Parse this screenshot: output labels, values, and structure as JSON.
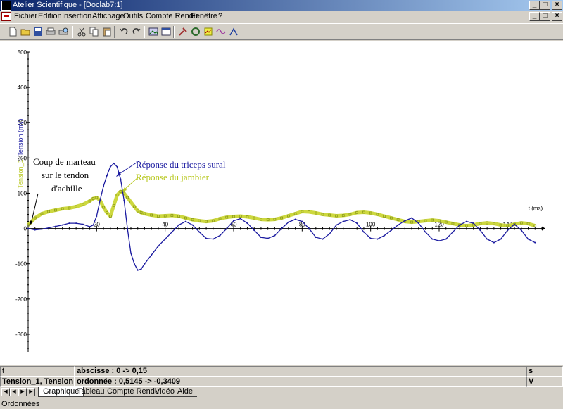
{
  "window": {
    "title": "Atelier Scientifique - [Doclab7:1]"
  },
  "menu": {
    "items": [
      "Fichier",
      "Edition",
      "Insertion",
      "Affichage",
      "Outils",
      "Compte Rendu",
      "Fenêtre",
      "?"
    ]
  },
  "toolbar": {
    "buttons": [
      "new-document-icon",
      "open-folder-icon",
      "save-icon",
      "print-icon",
      "print-preview-icon",
      "cut-icon",
      "copy-icon",
      "paste-icon",
      "undo-icon",
      "redo-icon",
      "image-icon",
      "window-icon",
      "tool-icon",
      "refresh-icon",
      "data-icon",
      "wave-icon",
      "graph-icon"
    ]
  },
  "chart_data": {
    "type": "line",
    "ylabel_parts": [
      "Tension_1",
      ", ",
      "Tension (mV)"
    ],
    "xlabel": "t (ms)",
    "xlim": [
      0,
      150
    ],
    "ylim": [
      -350,
      500
    ],
    "x_ticks": [
      20,
      40,
      60,
      80,
      100,
      120,
      140
    ],
    "x_tick_labels": [
      "20",
      "40",
      "60",
      "80",
      "100",
      "120",
      "140"
    ],
    "y_ticks": [
      500,
      400,
      300,
      200,
      100,
      0,
      -100,
      -200,
      -300
    ],
    "y_tick_labels": [
      "500",
      "400",
      "300",
      "200",
      "100",
      "-0",
      "-100",
      "-200",
      "-300"
    ],
    "series": [
      {
        "name": "Tension",
        "color": "#1a1aa0",
        "x": [
          0,
          2,
          4,
          6,
          8,
          10,
          12,
          14,
          16,
          18,
          19,
          20,
          21,
          22,
          23,
          24,
          25,
          26,
          27,
          28,
          29,
          30,
          31,
          32,
          33,
          34,
          36,
          38,
          40,
          42,
          44,
          46,
          48,
          50,
          52,
          54,
          56,
          58,
          60,
          62,
          64,
          66,
          68,
          70,
          72,
          74,
          76,
          78,
          80,
          82,
          84,
          86,
          88,
          90,
          92,
          94,
          96,
          98,
          100,
          102,
          104,
          106,
          108,
          110,
          112,
          114,
          116,
          118,
          120,
          122,
          124,
          126,
          128,
          130,
          132,
          134,
          136,
          138,
          140,
          142,
          144,
          146,
          148
        ],
        "y": [
          0,
          -4,
          -2,
          2,
          6,
          10,
          15,
          15,
          12,
          5,
          10,
          35,
          80,
          120,
          150,
          175,
          185,
          175,
          140,
          80,
          0,
          -70,
          -100,
          -118,
          -115,
          -100,
          -75,
          -50,
          -30,
          -10,
          10,
          20,
          10,
          -10,
          -28,
          -30,
          -20,
          0,
          22,
          28,
          15,
          -5,
          -25,
          -28,
          -20,
          0,
          18,
          26,
          20,
          0,
          -25,
          -30,
          -15,
          10,
          20,
          25,
          15,
          -10,
          -28,
          -30,
          -20,
          -5,
          10,
          22,
          30,
          15,
          -10,
          -30,
          -35,
          -30,
          -10,
          10,
          20,
          15,
          -5,
          -30,
          -40,
          -30,
          -5,
          12,
          -5,
          -30,
          -40
        ]
      },
      {
        "name": "Tension_1",
        "color": "#c8d42a",
        "x": [
          0,
          2,
          4,
          6,
          8,
          10,
          12,
          14,
          16,
          18,
          19,
          20,
          21,
          22,
          23,
          24,
          25,
          26,
          27,
          28,
          29,
          30,
          31,
          32,
          33,
          34,
          36,
          38,
          40,
          42,
          44,
          46,
          48,
          50,
          52,
          54,
          56,
          58,
          60,
          62,
          64,
          66,
          68,
          70,
          72,
          74,
          76,
          78,
          80,
          82,
          84,
          86,
          88,
          90,
          92,
          94,
          96,
          98,
          100,
          102,
          104,
          106,
          108,
          110,
          112,
          114,
          116,
          118,
          120,
          122,
          124,
          126,
          128,
          130,
          132,
          134,
          136,
          138,
          140,
          142,
          144,
          146,
          148
        ],
        "y": [
          10,
          30,
          42,
          48,
          52,
          56,
          58,
          62,
          68,
          78,
          85,
          88,
          80,
          60,
          45,
          35,
          65,
          95,
          105,
          100,
          88,
          75,
          62,
          50,
          45,
          42,
          38,
          35,
          36,
          37,
          35,
          30,
          25,
          22,
          20,
          22,
          28,
          32,
          34,
          35,
          33,
          30,
          26,
          25,
          26,
          30,
          36,
          42,
          48,
          47,
          44,
          40,
          38,
          36,
          37,
          40,
          45,
          46,
          44,
          40,
          35,
          30,
          25,
          20,
          18,
          20,
          22,
          24,
          22,
          18,
          14,
          10,
          8,
          10,
          14,
          16,
          14,
          10,
          8,
          12,
          16,
          14,
          8
        ]
      }
    ],
    "annotations": [
      {
        "text": "Coup de marteau",
        "color": "#000000"
      },
      {
        "text": "sur le tendon",
        "color": "#000000"
      },
      {
        "text": "d'achille",
        "color": "#000000"
      },
      {
        "text": "Réponse du triceps sural",
        "color": "#1a1aa0"
      },
      {
        "text": "Réponse du jambier",
        "color": "#b8c820"
      }
    ]
  },
  "status": {
    "row1": {
      "name": "t",
      "value": "abscisse : 0 -> 0,15",
      "unit": "s"
    },
    "row2": {
      "name": "Tension_1, Tension",
      "value": "ordonnée : 0,5145 -> -0,3409",
      "unit": "V"
    }
  },
  "tabs": {
    "items": [
      "Graphique",
      "Tableau",
      "Compte Rendu",
      "Vidéo",
      "Aide"
    ],
    "active": 0
  },
  "statusbar": {
    "text": "Ordonnées"
  }
}
